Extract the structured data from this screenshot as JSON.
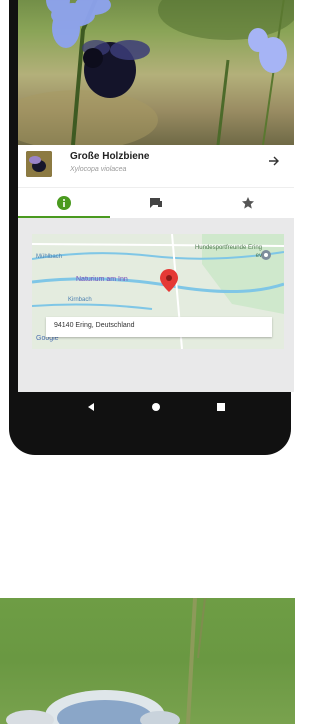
{
  "species": {
    "name": "Große Holzbiene",
    "latin_name": "Xylocopa violacea"
  },
  "tabs": [
    {
      "icon": "info-icon",
      "active": true
    },
    {
      "icon": "comments-icon",
      "active": false
    },
    {
      "icon": "star-icon",
      "active": false
    }
  ],
  "map": {
    "place_labels": [
      "Mühlbach",
      "Naturium am Inn",
      "Kirnbach",
      "Hundesportfreunde Ering ev"
    ],
    "provider": "Google",
    "address": "94140 Ering, Deutschland"
  },
  "colors": {
    "accent": "#4a9a1f",
    "pin": "#e53935",
    "map_water": "#7fc6e6",
    "map_park": "#cfe8cc"
  },
  "navbar": {
    "buttons": [
      "back-icon",
      "home-icon",
      "recents-icon"
    ]
  }
}
